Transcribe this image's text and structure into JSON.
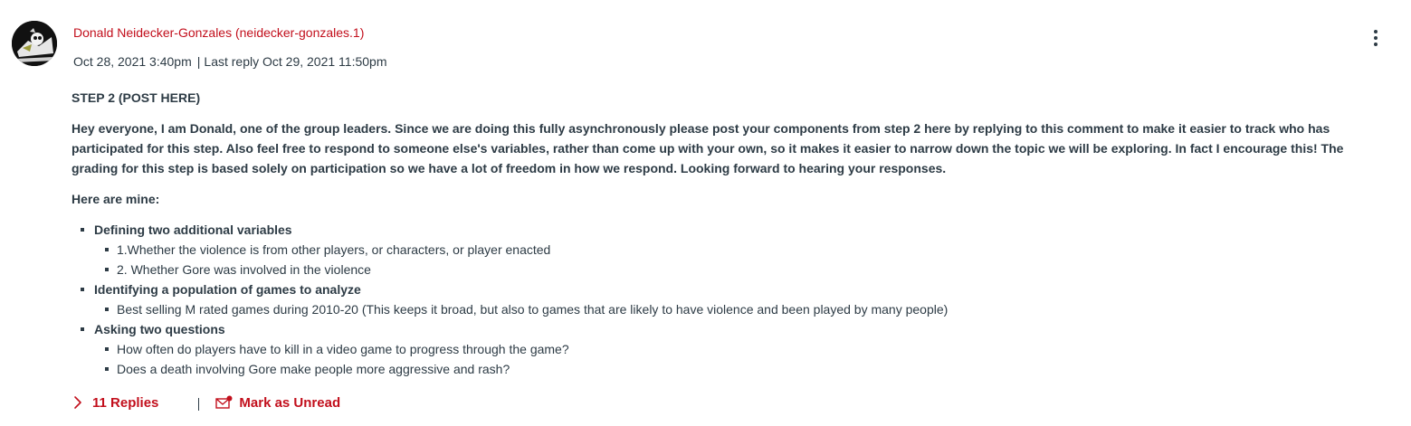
{
  "post": {
    "author": "Donald Neidecker-Gonzales (neidecker-gonzales.1)",
    "posted_at": "Oct 28, 2021 3:40pm",
    "separator": "|",
    "last_reply": "Last reply Oct 29, 2021 11:50pm",
    "title": "STEP 2 (POST HERE)",
    "intro": "Hey everyone, I am Donald, one of the group leaders. Since we are doing this fully asynchronously please post your components from step 2 here by replying to this comment to make it easier to track who has participated for this step. Also feel free to respond to someone else's variables, rather than come up with your own, so it makes it easier to narrow down the topic we will be exploring. In fact I encourage this! The grading for this step is based solely on participation so we have a lot of freedom in how we respond. Looking forward to hearing your responses.",
    "here_are_mine": "Here are mine:",
    "items": [
      {
        "label": "Defining two additional variables",
        "sub": [
          "1.Whether the violence is from other players, or characters, or player enacted",
          "2. Whether Gore was involved in the violence"
        ]
      },
      {
        "label": "Identifying a population of games to analyze",
        "sub": [
          "Best selling M rated games during 2010-20 (This keeps it broad, but also to games that are likely to have violence and been played by many people)"
        ]
      },
      {
        "label": "Asking two questions",
        "sub": [
          "How often do players have to kill in a video game to progress through the game?",
          "Does a death involving Gore make people more aggressive and rash?"
        ]
      }
    ]
  },
  "footer": {
    "replies_label": "11 Replies",
    "mark_unread_label": "Mark as Unread"
  },
  "icons": {
    "options": "kebab-menu-icon",
    "expand": "chevron-right-icon",
    "unread": "envelope-unread-icon"
  },
  "colors": {
    "accent": "#c20f1c",
    "text": "#2d3b45"
  }
}
